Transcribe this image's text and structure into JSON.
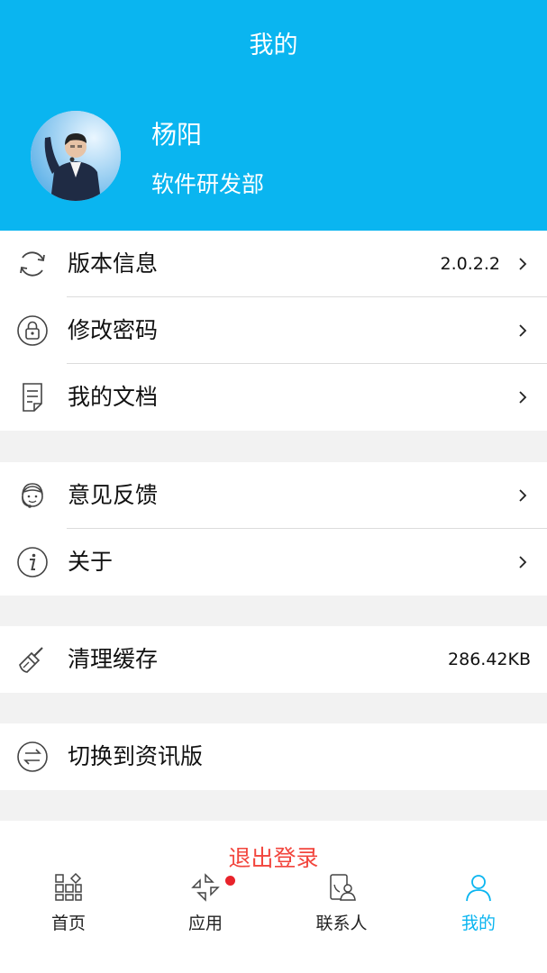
{
  "header": {
    "title": "我的"
  },
  "profile": {
    "name": "杨阳",
    "department": "软件研发部"
  },
  "menu_groups": [
    [
      {
        "label": "版本信息",
        "value": "2.0.2.2",
        "icon": "refresh-icon"
      },
      {
        "label": "修改密码",
        "icon": "lock-icon"
      },
      {
        "label": "我的文档",
        "icon": "document-icon"
      }
    ],
    [
      {
        "label": "意见反馈",
        "icon": "support-agent-icon"
      },
      {
        "label": "关于",
        "icon": "info-icon"
      }
    ],
    [
      {
        "label": "清理缓存",
        "value": "286.42KB",
        "icon": "broom-icon"
      }
    ],
    [
      {
        "label": "切换到资讯版",
        "icon": "switch-icon"
      }
    ]
  ],
  "logout": {
    "label": "退出登录"
  },
  "tabs": [
    {
      "label": "首页",
      "icon": "grid-icon"
    },
    {
      "label": "应用",
      "icon": "apps-icon",
      "badge": true
    },
    {
      "label": "联系人",
      "icon": "contacts-icon"
    },
    {
      "label": "我的",
      "icon": "person-icon",
      "active": true
    }
  ],
  "colors": {
    "primary": "#0ab5f0",
    "logout": "#f2453d",
    "badge": "#e8232b",
    "background": "#f2f2f2"
  }
}
